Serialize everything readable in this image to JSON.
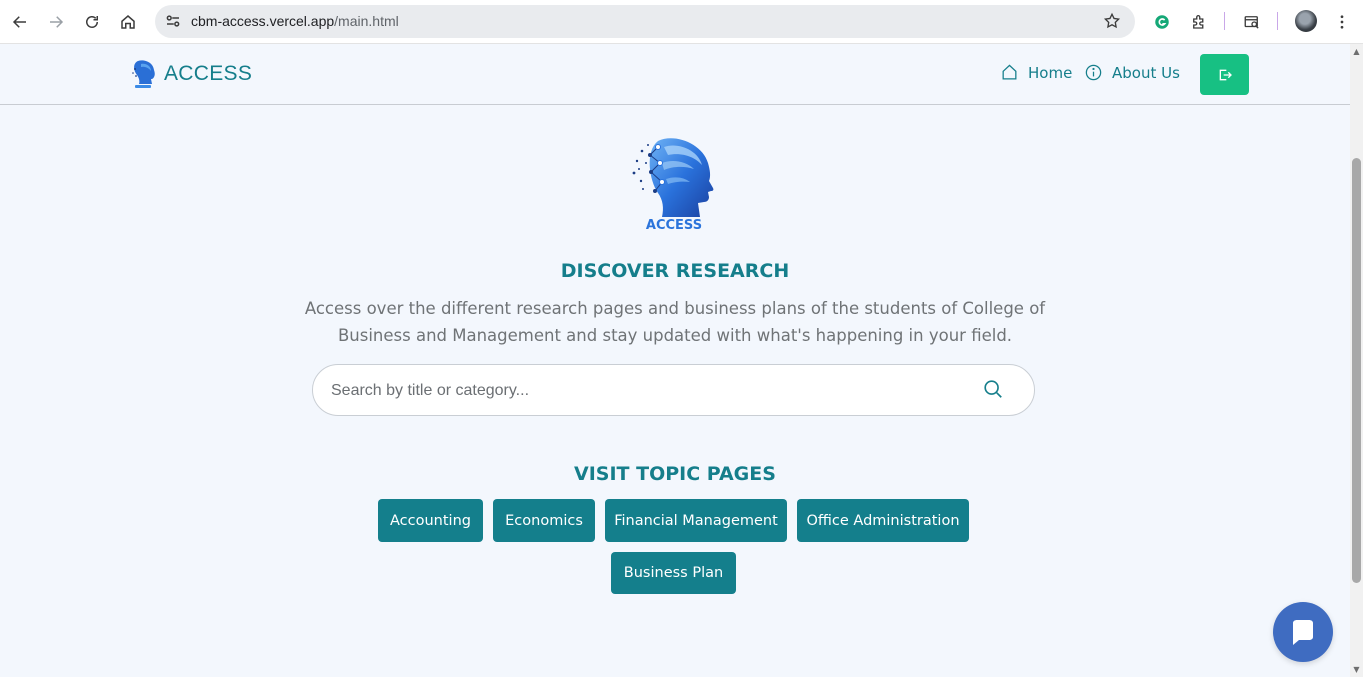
{
  "browser": {
    "url_host": "cbm-access.vercel.app",
    "url_path": "/main.html",
    "icons": [
      "back-icon",
      "forward-icon",
      "reload-icon",
      "home-icon",
      "site-settings-icon",
      "bookmark-star-icon",
      "grammarly-icon",
      "extensions-icon",
      "tab-search-icon",
      "profile-avatar",
      "kebab-menu-icon"
    ]
  },
  "header": {
    "brand": "ACCESS",
    "nav": [
      {
        "label": "Home",
        "icon": "home-outline-icon"
      },
      {
        "label": "About Us",
        "icon": "info-circle-icon"
      }
    ],
    "logout_icon": "logout-icon"
  },
  "hero": {
    "logo_text": "ACCESS",
    "title": "DISCOVER RESEARCH",
    "description": "Access over the different research pages and business plans of the students of College of Business and Management and stay updated with what's happening in your field."
  },
  "search": {
    "placeholder": "Search by title or category...",
    "value": ""
  },
  "topics": {
    "title": "VISIT TOPIC PAGES",
    "items": [
      "Accounting",
      "Economics",
      "Financial Management",
      "Office Administration",
      "Business Plan"
    ]
  },
  "colors": {
    "accent": "#157e8b",
    "button": "#147f8c",
    "logout": "#17c083",
    "chat": "#3f6cc1",
    "background": "#f3f7fd"
  }
}
